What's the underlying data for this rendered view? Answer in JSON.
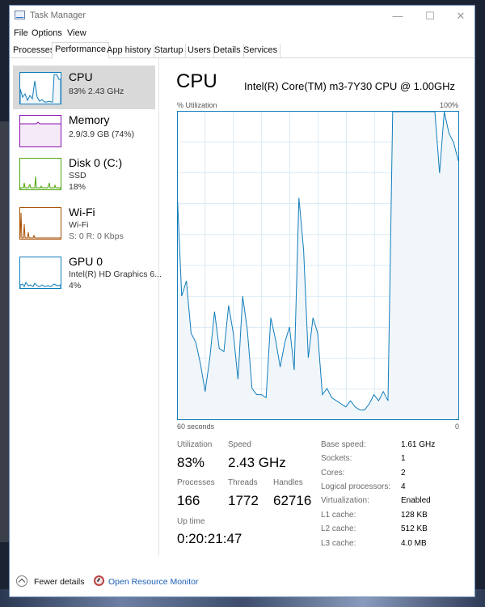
{
  "window": {
    "title": "Task Manager",
    "min": "—",
    "max": "☐",
    "close": "✕"
  },
  "menu": [
    "File",
    "Options",
    "View"
  ],
  "tabs": [
    "Processes",
    "Performance",
    "App history",
    "Startup",
    "Users",
    "Details",
    "Services"
  ],
  "active_tab": "Performance",
  "resources": [
    {
      "name": "CPU",
      "line1": "83%  2.43 GHz",
      "color": "#117dbb",
      "selected": true
    },
    {
      "name": "Memory",
      "line1": "2.9/3.9 GB (74%)",
      "color": "#8b12ae"
    },
    {
      "name": "Disk 0 (C:)",
      "line1": "SSD",
      "line2": "18%",
      "color": "#4da60c"
    },
    {
      "name": "Wi-Fi",
      "line1": "Wi-Fi",
      "line2": "S: 0  R: 0 Kbps",
      "color": "#a74f01"
    },
    {
      "name": "GPU 0",
      "line1": "Intel(R) HD Graphics 6...",
      "line2": "4%",
      "color": "#117dbb"
    }
  ],
  "cpu": {
    "title": "CPU",
    "model": "Intel(R) Core(TM) m3-7Y30 CPU @ 1.00GHz",
    "y_label": "% Utilization",
    "y_max_label": "100%",
    "x_left_label": "60 seconds",
    "x_right_label": "0",
    "graph_color": "#117dbb",
    "graph_fill": "#f1f6fa",
    "grid_color": "#d9eaf4"
  },
  "chart_data": {
    "type": "area",
    "title": "",
    "xlabel": "60 seconds",
    "ylabel": "% Utilization",
    "xlim": [
      60,
      0
    ],
    "ylim": [
      0,
      100
    ],
    "grid": true,
    "x": [
      60,
      59,
      58,
      57,
      56,
      55,
      54,
      53,
      52,
      51,
      50,
      49,
      48,
      47,
      46,
      45,
      44,
      43,
      42,
      41,
      40,
      39,
      38,
      37,
      36,
      35,
      34,
      33,
      32,
      31,
      30,
      29,
      28,
      27,
      26,
      25,
      24,
      23,
      22,
      21,
      20,
      19,
      18,
      17,
      16,
      15,
      14,
      13,
      12,
      11,
      10,
      9,
      8,
      7,
      6,
      5,
      4,
      3,
      2,
      1,
      0
    ],
    "series": [
      {
        "values": [
          75,
          40,
          45,
          28,
          25,
          18,
          9,
          20,
          35,
          23,
          22,
          37,
          28,
          13,
          40,
          29,
          10,
          8,
          8,
          7,
          33,
          26,
          17,
          25,
          30,
          16,
          72,
          55,
          20,
          33,
          28,
          8,
          10,
          7,
          6,
          5,
          4,
          6,
          4,
          3,
          3,
          5,
          8,
          6,
          9,
          6,
          100,
          100,
          100,
          100,
          100,
          100,
          100,
          100,
          100,
          100,
          80,
          100,
          93,
          90,
          84
        ]
      }
    ]
  },
  "stats": {
    "utilization_label": "Utilization",
    "utilization": "83%",
    "speed_label": "Speed",
    "speed": "2.43 GHz",
    "processes_label": "Processes",
    "processes": "166",
    "threads_label": "Threads",
    "threads": "1772",
    "handles_label": "Handles",
    "handles": "62716",
    "uptime_label": "Up time",
    "uptime": "0:20:21:47"
  },
  "specs": [
    {
      "key": "Base speed:",
      "value": "1.61 GHz"
    },
    {
      "key": "Sockets:",
      "value": "1"
    },
    {
      "key": "Cores:",
      "value": "2"
    },
    {
      "key": "Logical processors:",
      "value": "4"
    },
    {
      "key": "Virtualization:",
      "value": "Enabled"
    },
    {
      "key": "L1 cache:",
      "value": "128 KB"
    },
    {
      "key": "L2 cache:",
      "value": "512 KB"
    },
    {
      "key": "L3 cache:",
      "value": "4.0 MB"
    }
  ],
  "footer": {
    "fewer_details": "Fewer details",
    "open_resource_monitor": "Open Resource Monitor"
  }
}
